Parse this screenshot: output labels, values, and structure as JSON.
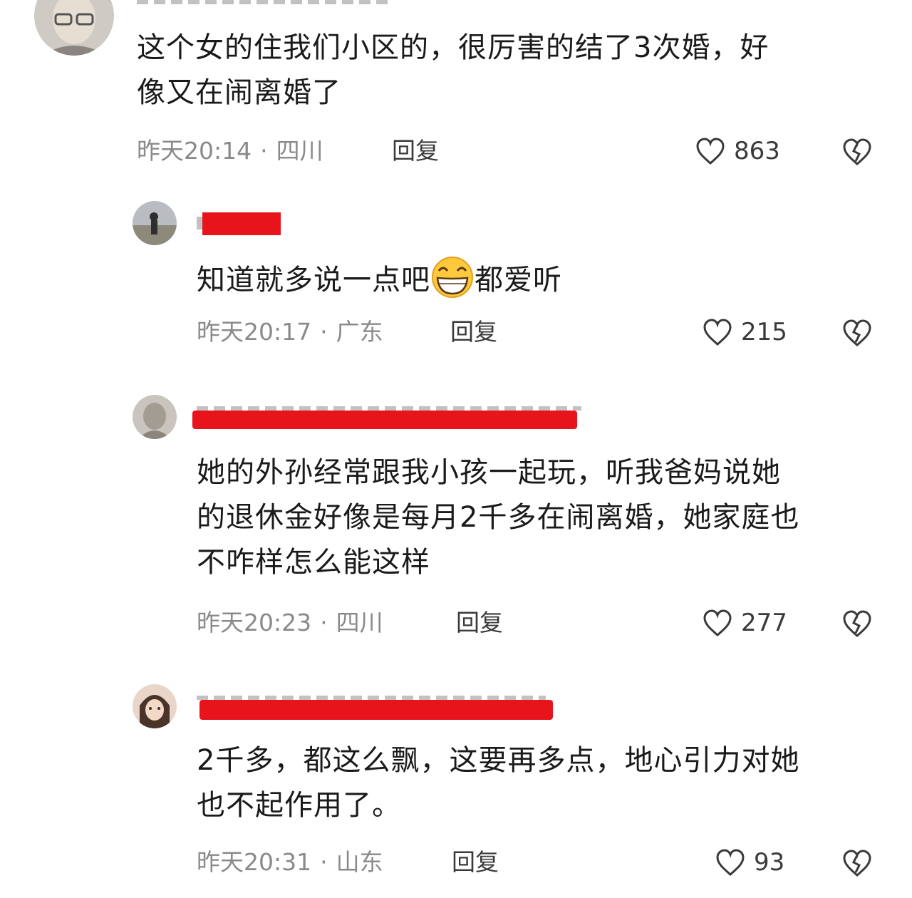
{
  "comments": [
    {
      "text_lines": [
        "这个女的住我们小区的，很厉害的结了3次婚，好",
        "像又在闹离婚了"
      ],
      "time": "昨天20:14",
      "location": "四川",
      "reply_label": "回复",
      "likes": "863"
    },
    {
      "text_before_emoji": "知道就多说一点吧",
      "emoji": "grinning-face-emoji",
      "text_after_emoji": "都爱听",
      "time": "昨天20:17",
      "location": "广东",
      "reply_label": "回复",
      "likes": "215"
    },
    {
      "text_lines": [
        "她的外孙经常跟我小孩一起玩，听我爸妈说她",
        "的退休金好像是每月2千多在闹离婚，她家庭也",
        "不咋样怎么能这样"
      ],
      "time": "昨天20:23",
      "location": "四川",
      "reply_label": "回复",
      "likes": "277"
    },
    {
      "text_lines": [
        "2千多，都这么飘，这要再多点，地心引力对她",
        "也不起作用了。"
      ],
      "time": "昨天20:31",
      "location": "山东",
      "reply_label": "回复",
      "likes": "93"
    }
  ],
  "icons": {
    "like": "heart-outline-icon",
    "dislike": "broken-heart-icon"
  },
  "colors": {
    "redaction": "#e8141c",
    "meta_text": "#8a8a8a",
    "body_text": "#1a1a1a"
  }
}
